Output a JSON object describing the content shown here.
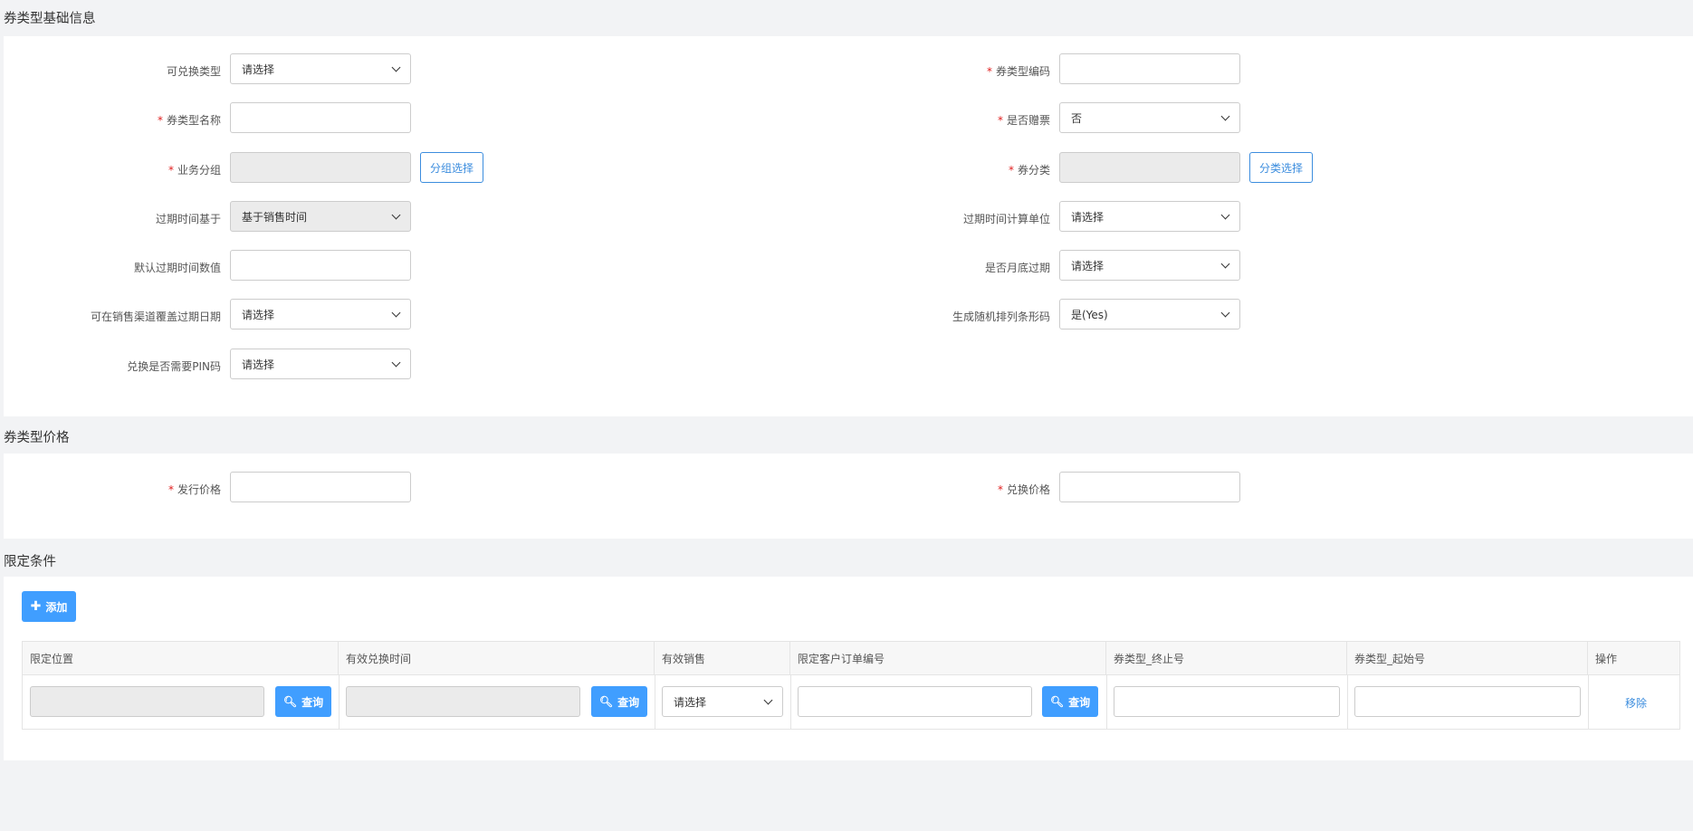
{
  "sections": {
    "basic_title": "券类型基础信息",
    "price_title": "券类型价格",
    "limit_title": "限定条件"
  },
  "basic": {
    "redeem_type": {
      "label": "可兑换类型",
      "value": "请选择"
    },
    "coupon_code": {
      "label": "券类型编码",
      "value": ""
    },
    "coupon_name": {
      "label": "券类型名称",
      "value": ""
    },
    "is_gift": {
      "label": "是否赠票",
      "value": "否"
    },
    "business_group": {
      "label": "业务分组",
      "value": "",
      "button": "分组选择"
    },
    "coupon_category": {
      "label": "券分类",
      "value": "",
      "button": "分类选择"
    },
    "expiry_basis": {
      "label": "过期时间基于",
      "value": "基于销售时间"
    },
    "expiry_unit": {
      "label": "过期时间计算单位",
      "value": "请选择"
    },
    "default_expiry": {
      "label": "默认过期时间数值",
      "value": ""
    },
    "month_end_expiry": {
      "label": "是否月底过期",
      "value": "请选择"
    },
    "channel_override": {
      "label": "可在销售渠道覆盖过期日期",
      "value": "请选择"
    },
    "random_barcode": {
      "label": "生成随机排列条形码",
      "value": "是(Yes)"
    },
    "pin_required": {
      "label": "兑换是否需要PIN码",
      "value": "请选择"
    }
  },
  "price": {
    "issue_price": {
      "label": "发行价格",
      "value": ""
    },
    "redeem_price": {
      "label": "兑换价格",
      "value": ""
    }
  },
  "limits": {
    "add_button": "添加",
    "columns": [
      "限定位置",
      "有效兑换时间",
      "有效销售",
      "限定客户订单编号",
      "券类型_终止号",
      "券类型_起始号",
      "操作"
    ],
    "row": {
      "location": "",
      "redeem_time": "",
      "sales": "请选择",
      "order_no": "",
      "end_no": "",
      "start_no": "",
      "query_label": "查询",
      "remove_label": "移除"
    }
  }
}
